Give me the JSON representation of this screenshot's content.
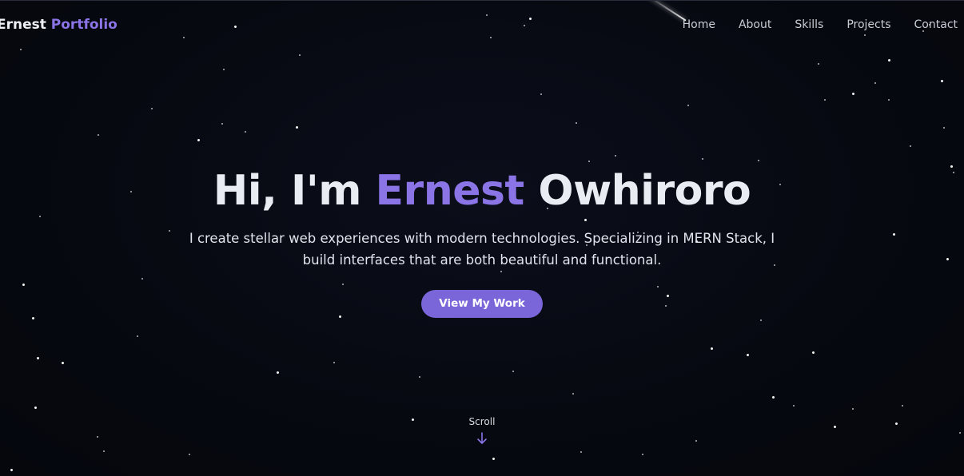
{
  "brand": {
    "first": "Ernest",
    "second": "Portfolio"
  },
  "nav": {
    "items": [
      {
        "label": "Home"
      },
      {
        "label": "About"
      },
      {
        "label": "Skills"
      },
      {
        "label": "Projects"
      },
      {
        "label": "Contact"
      }
    ]
  },
  "hero": {
    "greeting": "Hi, I'm",
    "first_name": "Ernest",
    "last_name": "Owhiroro",
    "description": "I create stellar web experiences with modern technologies. Specializing in MERN Stack, I build interfaces that are both beautiful and functional.",
    "cta_label": "View My Work"
  },
  "scroll": {
    "label": "Scroll",
    "icon": "arrow-down-icon"
  },
  "colors": {
    "background": "#060810",
    "accent": "#8b74e6",
    "button": "#7a66d9",
    "text": "#e9ecf3"
  }
}
